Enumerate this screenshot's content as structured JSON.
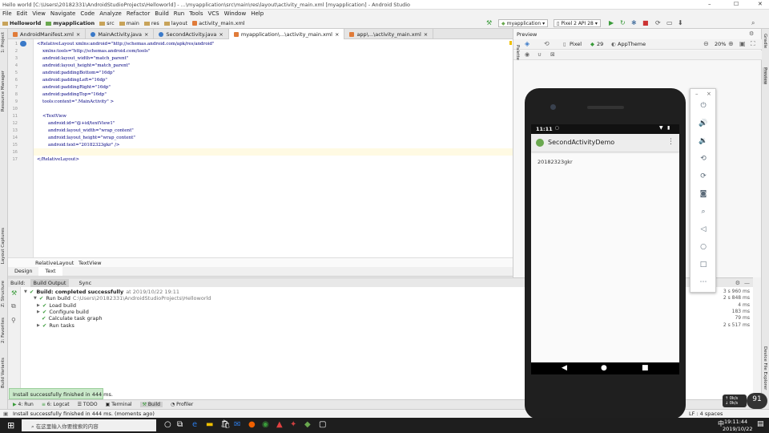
{
  "window": {
    "title": "Hello world [C:\\Users\\20182331\\AndroidStudioProjects\\Helloworld] - ...\\myapplication\\src\\main\\res\\layout\\activity_main.xml [myapplication] - Android Studio",
    "min": "–",
    "max": "☐",
    "close": "✕"
  },
  "menu": [
    "File",
    "Edit",
    "View",
    "Navigate",
    "Code",
    "Analyze",
    "Refactor",
    "Build",
    "Run",
    "Tools",
    "VCS",
    "Window",
    "Help"
  ],
  "nav": {
    "crumbs": [
      "Helloworld",
      "myapplication",
      "src",
      "main",
      "res",
      "layout",
      "activity_main.xml"
    ],
    "run_config": "myapplication",
    "device": "Pixel 2 API 28"
  },
  "tabs": [
    {
      "label": "AndroidManifest.xml",
      "color": "#e07b39",
      "active": false
    },
    {
      "label": "MainActivity.java",
      "color": "#3a79c8",
      "active": false
    },
    {
      "label": "SecondActivity.java",
      "color": "#3a79c8",
      "active": false
    },
    {
      "label": "myapplication\\...\\activity_main.xml",
      "color": "#e07b39",
      "active": true
    },
    {
      "label": "app\\...\\activity_main.xml",
      "color": "#e07b39",
      "active": false
    }
  ],
  "code": [
    "<RelativeLayout xmlns:android=\"http://schemas.android.com/apk/res/android\"",
    "    xmlns:tools=\"http://schemas.android.com/tools\"",
    "    android:layout_width=\"match_parent\"",
    "    android:layout_height=\"match_parent\"",
    "    android:paddingBottom=\"16dp\"",
    "    android:paddingLeft=\"16dp\"",
    "    android:paddingRight=\"16dp\"",
    "    android:paddingTop=\"16dp\"",
    "    tools:context=\".MainActivity\" >",
    "",
    "    <TextView",
    "        android:id=\"@+id/textView1\"",
    "        android:layout_width=\"wrap_content\"",
    "        android:layout_height=\"wrap_content\"",
    "        android:text=\"20182323gkr\" />",
    "",
    "</RelativeLayout>"
  ],
  "editor_breadcrumb": [
    "RelativeLayout",
    "TextView"
  ],
  "design_tabs": [
    "Design",
    "Text"
  ],
  "build": {
    "header_label": "Build:",
    "tabs": [
      "Build Output",
      "Sync"
    ],
    "rows": [
      {
        "text": "Build: completed successfully",
        "meta": "at 2019/10/22 19:11",
        "indent": 0,
        "dur": "3 s 960 ms"
      },
      {
        "text": "Run build",
        "meta": "C:\\Users\\20182331\\AndroidStudioProjects\\Helloworld",
        "indent": 1,
        "dur": "2 s 848 ms"
      },
      {
        "text": "Load build",
        "meta": "",
        "indent": 2,
        "dur": "4 ms"
      },
      {
        "text": "Configure build",
        "meta": "",
        "indent": 2,
        "dur": "183 ms"
      },
      {
        "text": "Calculate task graph",
        "meta": "",
        "indent": 2,
        "dur": "79 ms"
      },
      {
        "text": "Run tasks",
        "meta": "",
        "indent": 2,
        "dur": "2 s 517 ms"
      }
    ]
  },
  "bottom_tools": [
    "4: Run",
    "6: Logcat",
    "TODO",
    "Terminal",
    "Build",
    "Profiler"
  ],
  "toast": "Install successfully finished in 444 ms.",
  "status": "Install successfully finished in 444 ms. (moments ago)",
  "status_right": "LF :  4 spaces",
  "preview": {
    "title": "Preview",
    "device": "Pixel",
    "api": "29",
    "theme": "AppTheme",
    "zoom": "20%"
  },
  "left_tools": [
    "1: Project",
    "Resource Manager",
    "Layout Captures",
    "Z: Structure",
    "2: Favorites",
    "Build Variants"
  ],
  "right_tools": [
    "Gradle",
    "Preview",
    "Device File Explorer"
  ],
  "phone": {
    "time": "11:11",
    "app_title": "SecondActivityDemo",
    "text": "20182323gkr"
  },
  "meter": "91",
  "speed": {
    "up": "0k/s",
    "down": "0k/s"
  },
  "taskbar": {
    "search": "在这里输入你要搜索的内容",
    "time": "19:11:44",
    "date": "2019/10/22",
    "lang": "中"
  }
}
